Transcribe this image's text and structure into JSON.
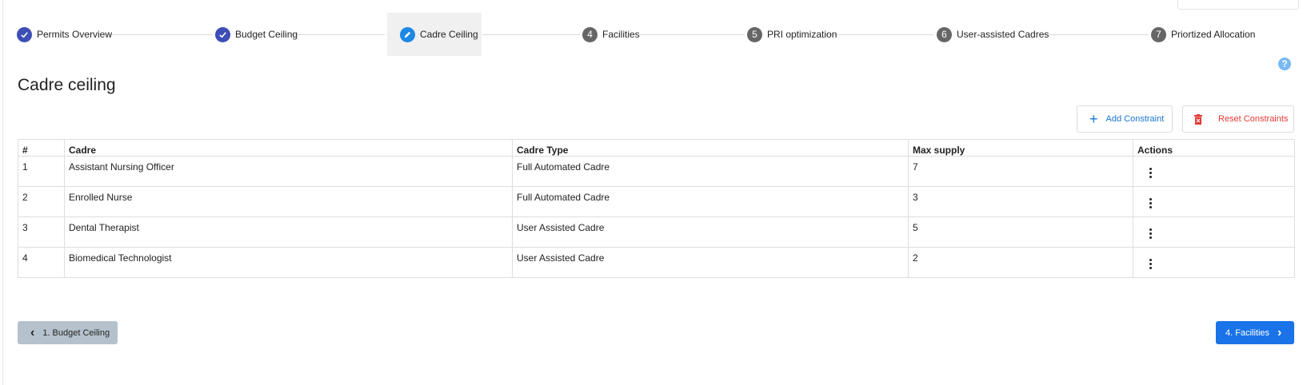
{
  "stepper": {
    "steps": [
      {
        "label": "Permits Overview",
        "status": "done",
        "icon": "check-icon"
      },
      {
        "label": "Budget Ceiling",
        "status": "done",
        "icon": "check-icon"
      },
      {
        "label": "Cadre Ceiling",
        "status": "active",
        "icon": "pencil-icon"
      },
      {
        "label": "Facilities",
        "status": "todo",
        "number": "4"
      },
      {
        "label": "PRI optimization",
        "status": "todo",
        "number": "5"
      },
      {
        "label": "User-assisted Cadres",
        "status": "todo",
        "number": "6"
      },
      {
        "label": "Priortized Allocation",
        "status": "todo",
        "number": "7"
      }
    ]
  },
  "help": {
    "glyph": "?"
  },
  "page": {
    "title": "Cadre ceiling"
  },
  "toolbar": {
    "add_label": "Add Constraint",
    "add_icon": "plus-icon",
    "reset_label": "Reset Constraints",
    "reset_icon": "trash-icon"
  },
  "table": {
    "headers": [
      "#",
      "Cadre",
      "Cadre Type",
      "Max supply",
      "Actions"
    ],
    "rows": [
      {
        "num": "1",
        "cadre": "Assistant Nursing Officer",
        "type": "Full Automated Cadre",
        "max": "7"
      },
      {
        "num": "2",
        "cadre": "Enrolled Nurse",
        "type": "Full Automated Cadre",
        "max": "3"
      },
      {
        "num": "3",
        "cadre": "Dental Therapist",
        "type": "User Assisted Cadre",
        "max": "5"
      },
      {
        "num": "4",
        "cadre": "Biomedical Technologist",
        "type": "User Assisted Cadre",
        "max": "2"
      }
    ]
  },
  "nav": {
    "back_label": "1. Budget Ceiling",
    "next_label": "4. Facilities"
  },
  "colors": {
    "done": "#3d4fb5",
    "active": "#1e88e5",
    "todo": "#666666",
    "primary": "#1a73e8",
    "danger": "#e53935"
  }
}
